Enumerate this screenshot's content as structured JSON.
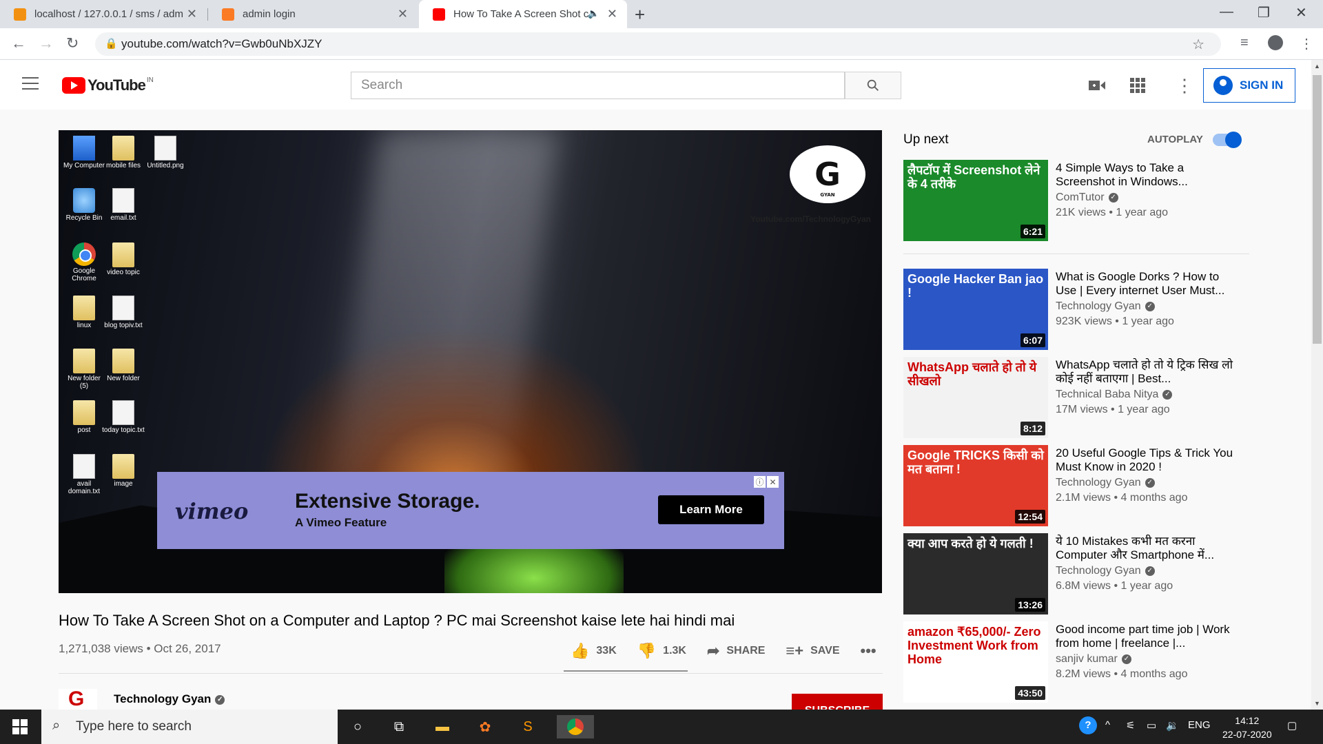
{
  "browser": {
    "tabs": [
      {
        "title": "localhost / 127.0.0.1 / sms / adm",
        "active": false
      },
      {
        "title": "admin login",
        "active": false
      },
      {
        "title": "How To Take A Screen Shot c",
        "active": true
      }
    ],
    "url": "youtube.com/watch?v=Gwb0uNbXJZY"
  },
  "youtube": {
    "logo_text": "YouTube",
    "region": "IN",
    "search_placeholder": "Search",
    "signin_label": "SIGN IN"
  },
  "player": {
    "desktop_icons": [
      {
        "label": "My Computer",
        "kind": "pc"
      },
      {
        "label": "mobile files",
        "kind": "folder"
      },
      {
        "label": "Untitled.png",
        "kind": "file"
      },
      {
        "label": "Recycle Bin",
        "kind": "bin"
      },
      {
        "label": "email.txt",
        "kind": "file"
      },
      {
        "label": "Google Chrome",
        "kind": "chrome"
      },
      {
        "label": "video topic",
        "kind": "folder"
      },
      {
        "label": "linux",
        "kind": "folder"
      },
      {
        "label": "blog topiv.txt",
        "kind": "file"
      },
      {
        "label": "New folder (5)",
        "kind": "folder"
      },
      {
        "label": "New folder",
        "kind": "folder"
      },
      {
        "label": "post",
        "kind": "folder"
      },
      {
        "label": "today topic.txt",
        "kind": "file"
      },
      {
        "label": "avail domain.txt",
        "kind": "file"
      },
      {
        "label": "image",
        "kind": "folder"
      }
    ],
    "brand_letter": "G",
    "brand_sub": "GYAN",
    "brand_url": "Youtube.com/TechnologyGyan",
    "ad": {
      "brand": "vimeo",
      "headline": "Extensive Storage.",
      "subline": "A Vimeo Feature",
      "cta": "Learn More"
    }
  },
  "video": {
    "title": "How To Take A Screen Shot on a Computer and Laptop ? PC mai Screenshot kaise lete hai hindi mai",
    "views_date": "1,271,038 views • Oct 26, 2017",
    "likes": "33K",
    "dislikes": "1.3K",
    "share_label": "SHARE",
    "save_label": "SAVE",
    "channel_name": "Technology Gyan",
    "subscribe_label": "SUBSCRIBE"
  },
  "sidebar": {
    "up_next_label": "Up next",
    "autoplay_label": "AUTOPLAY",
    "autoplay_on": true,
    "items": [
      {
        "title": "4 Simple Ways to Take a Screenshot in Windows...",
        "channel": "ComTutor",
        "meta": "21K views • 1 year ago",
        "duration": "6:21",
        "thumb_text": "लैपटॉप में Screenshot लेने के 4 तरीके",
        "bg": "#1a8a2a"
      },
      {
        "title": "What is Google Dorks ? How to Use | Every internet User Must...",
        "channel": "Technology Gyan",
        "meta": "923K views • 1 year ago",
        "duration": "6:07",
        "thumb_text": "Google Hacker Ban jao !",
        "bg": "#2a56c6"
      },
      {
        "title": "WhatsApp चलाते हो तो ये ट्रिक सिख लो कोई नहीं बताएगा | Best...",
        "channel": "Technical Baba Nitya",
        "meta": "17M views • 1 year ago",
        "duration": "8:12",
        "thumb_text": "WhatsApp चलाते हो तो ये सीखलो",
        "bg": "#f2f2f2"
      },
      {
        "title": "20 Useful Google Tips & Trick You Must Know in 2020 !",
        "channel": "Technology Gyan",
        "meta": "2.1M views • 4 months ago",
        "duration": "12:54",
        "thumb_text": "Google TRICKS किसी को मत बताना !",
        "bg": "#e23a2a"
      },
      {
        "title": "ये 10 Mistakes कभी मत करना Computer और Smartphone में...",
        "channel": "Technology Gyan",
        "meta": "6.8M views • 1 year ago",
        "duration": "13:26",
        "thumb_text": "क्या आप करते हो ये गलती !",
        "bg": "#2b2b2b"
      },
      {
        "title": "Good income part time job | Work from home | freelance |...",
        "channel": "sanjiv kumar",
        "meta": "8.2M views • 4 months ago",
        "duration": "43:50",
        "thumb_text": "amazon ₹65,000/- Zero Investment Work from Home",
        "bg": "#ffffff"
      }
    ]
  },
  "taskbar": {
    "search_placeholder": "Type here to search",
    "lang": "ENG",
    "time": "14:12",
    "date": "22-07-2020"
  }
}
